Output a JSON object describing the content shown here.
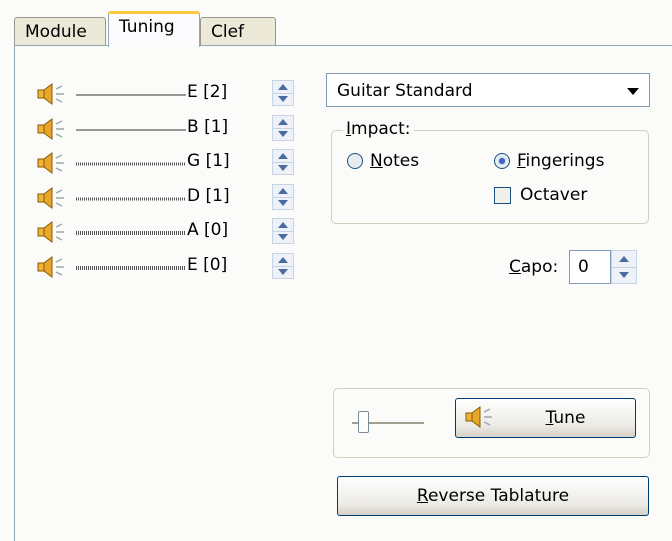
{
  "tabs": [
    {
      "label": "Module",
      "active": false
    },
    {
      "label": "Tuning",
      "active": true
    },
    {
      "label": "Clef",
      "active": false
    }
  ],
  "strings": [
    {
      "name": "E [2]",
      "line_style": "plain"
    },
    {
      "name": "B [1]",
      "line_style": "plain"
    },
    {
      "name": "G [1]",
      "line_style": "wound"
    },
    {
      "name": "D [1]",
      "line_style": "wound"
    },
    {
      "name": "A [0]",
      "line_style": "wound"
    },
    {
      "name": "E [0]",
      "line_style": "wound"
    }
  ],
  "tuning_preset": {
    "selected": "Guitar Standard"
  },
  "impact": {
    "label": "Impact:",
    "label_accel": "I",
    "label_rest": "mpact:",
    "notes": {
      "accel": "N",
      "rest": "otes",
      "checked": false
    },
    "fingerings": {
      "accel": "F",
      "rest": "ingerings",
      "checked": true
    },
    "octaver": {
      "label": "Octaver",
      "checked": false
    }
  },
  "capo": {
    "accel": "C",
    "rest": "apo:",
    "value": "0"
  },
  "tune": {
    "accel": "T",
    "rest": "une",
    "volume": 0.15
  },
  "reverse": {
    "accel": "R",
    "rest": "everse Tablature"
  },
  "colors": {
    "accent": "#ffc83c",
    "border": "#91a7b4",
    "speaker": "#e8a62a"
  }
}
